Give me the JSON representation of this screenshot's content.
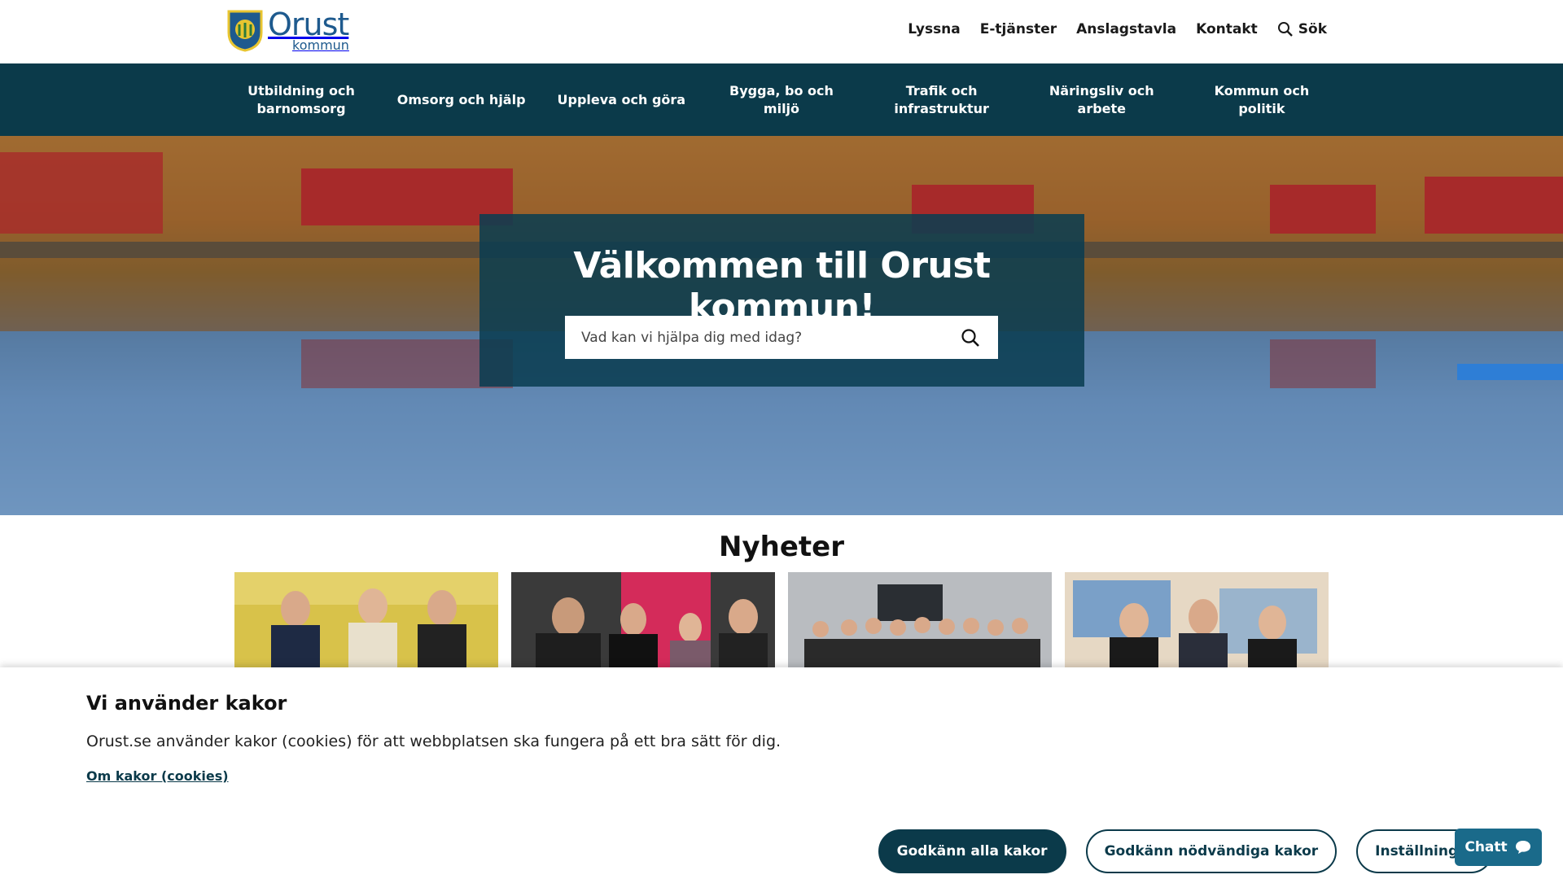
{
  "header": {
    "logo": {
      "name": "Orust",
      "sub": "kommun"
    },
    "links": [
      {
        "label": "Lyssna"
      },
      {
        "label": "E-tjänster"
      },
      {
        "label": "Anslagstavla"
      },
      {
        "label": "Kontakt"
      },
      {
        "label": "Sök",
        "icon": "search-icon"
      }
    ]
  },
  "nav": {
    "items": [
      {
        "label": "Utbildning och barnomsorg"
      },
      {
        "label": "Omsorg och hjälp"
      },
      {
        "label": "Uppleva och göra"
      },
      {
        "label": "Bygga, bo och miljö"
      },
      {
        "label": "Trafik och infrastruktur"
      },
      {
        "label": "Näringsliv och arbete"
      },
      {
        "label": "Kommun och politik"
      }
    ]
  },
  "hero": {
    "title": "Välkommen till Orust kommun!",
    "search_placeholder": "Vad kan vi hjälpa dig med idag?"
  },
  "news": {
    "title": "Nyheter",
    "cards": [
      {
        "image": "news-photo-1"
      },
      {
        "image": "news-photo-2"
      },
      {
        "image": "news-photo-3"
      },
      {
        "image": "news-photo-4"
      }
    ]
  },
  "cookie": {
    "title": "Vi använder kakor",
    "text": "Orust.se använder kakor (cookies) för att webbplatsen ska fungera på ett bra sätt för dig.",
    "link": "Om kakor (cookies)",
    "accept_all": "Godkänn alla kakor",
    "accept_necessary": "Godkänn nödvändiga kakor",
    "settings": "Inställningar"
  },
  "chat": {
    "label": "Chatt",
    "icon": "chat-bubble-icon"
  },
  "colors": {
    "primary": "#0b3a4a",
    "brand_blue": "#1e5a8e",
    "chat": "#1a6a8a"
  }
}
